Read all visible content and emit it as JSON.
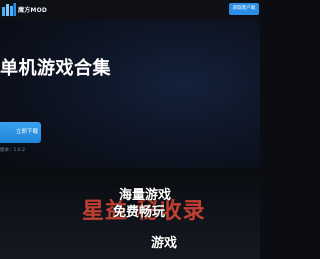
{
  "header": {
    "logo_text": "魔方MOD",
    "action_button": "获取客户端"
  },
  "hero": {
    "title": "单机游戏合集",
    "download_button": "立即下载",
    "version_text": "版本：1.0.2"
  },
  "feature": {
    "line1": "海量游戏",
    "line2": "免费畅玩",
    "line3": "游戏"
  },
  "watermark": {
    "text": "星益 秘收录"
  },
  "colors": {
    "accent": "#2b8ee6",
    "watermark": "#ff4f3a",
    "background": "#0b0d12"
  }
}
